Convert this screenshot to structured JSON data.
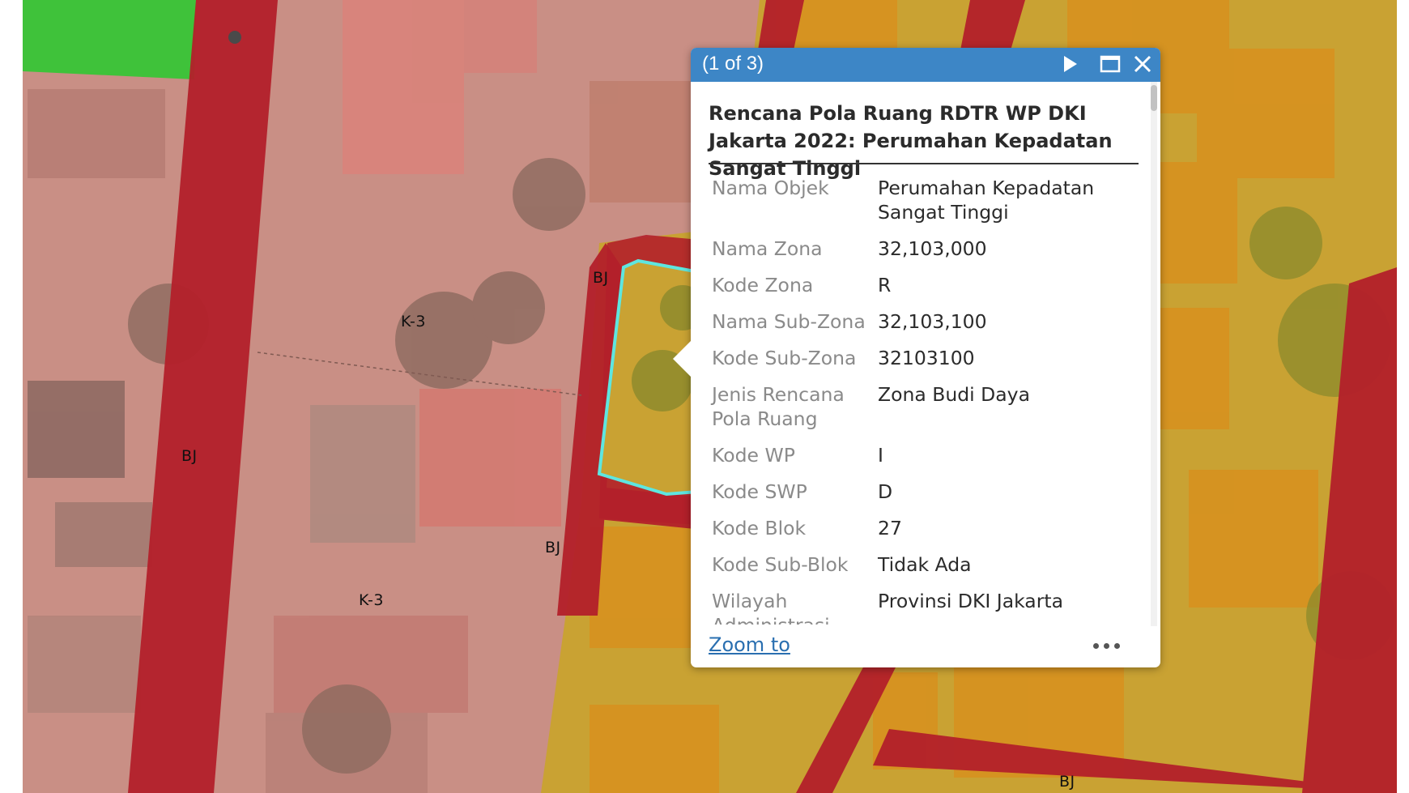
{
  "map": {
    "labels": [
      "K-3",
      "BJ",
      "K-3",
      "BJ",
      "BJ",
      "BJ"
    ],
    "colors": {
      "road": "#b3202a",
      "commercial_zone": "#d47a78",
      "residential_zone": "#c9a233",
      "green_zone": "#3fc23a",
      "selection_outline": "#5ee6e0"
    }
  },
  "popup": {
    "counter": "(1 of 3)",
    "header_icons": [
      "play-icon",
      "maximize-icon",
      "close-icon"
    ],
    "title": "Rencana Pola Ruang RDTR WP DKI Jakarta 2022: Perumahan Kepadatan Sangat Tinggi",
    "attributes": [
      {
        "key": "Nama Objek",
        "value": "Perumahan Kepadatan Sangat Tinggi"
      },
      {
        "key": "Nama Zona",
        "value": "32,103,000"
      },
      {
        "key": "Kode Zona",
        "value": "R"
      },
      {
        "key": "Nama Sub-Zona",
        "value": "32,103,100"
      },
      {
        "key": "Kode Sub-Zona",
        "value": "32103100"
      },
      {
        "key": "Jenis Rencana Pola Ruang",
        "value": "Zona Budi Daya"
      },
      {
        "key": "Kode WP",
        "value": "I"
      },
      {
        "key": "Kode SWP",
        "value": "D"
      },
      {
        "key": "Kode Blok",
        "value": "27"
      },
      {
        "key": "Kode Sub-Blok",
        "value": "Tidak Ada"
      },
      {
        "key": "Wilayah Administrasi",
        "value": "Provinsi DKI Jakarta"
      }
    ],
    "zoom_label": "Zoom to",
    "more_icon": "more-icon",
    "accent_color": "#3d86c6"
  }
}
